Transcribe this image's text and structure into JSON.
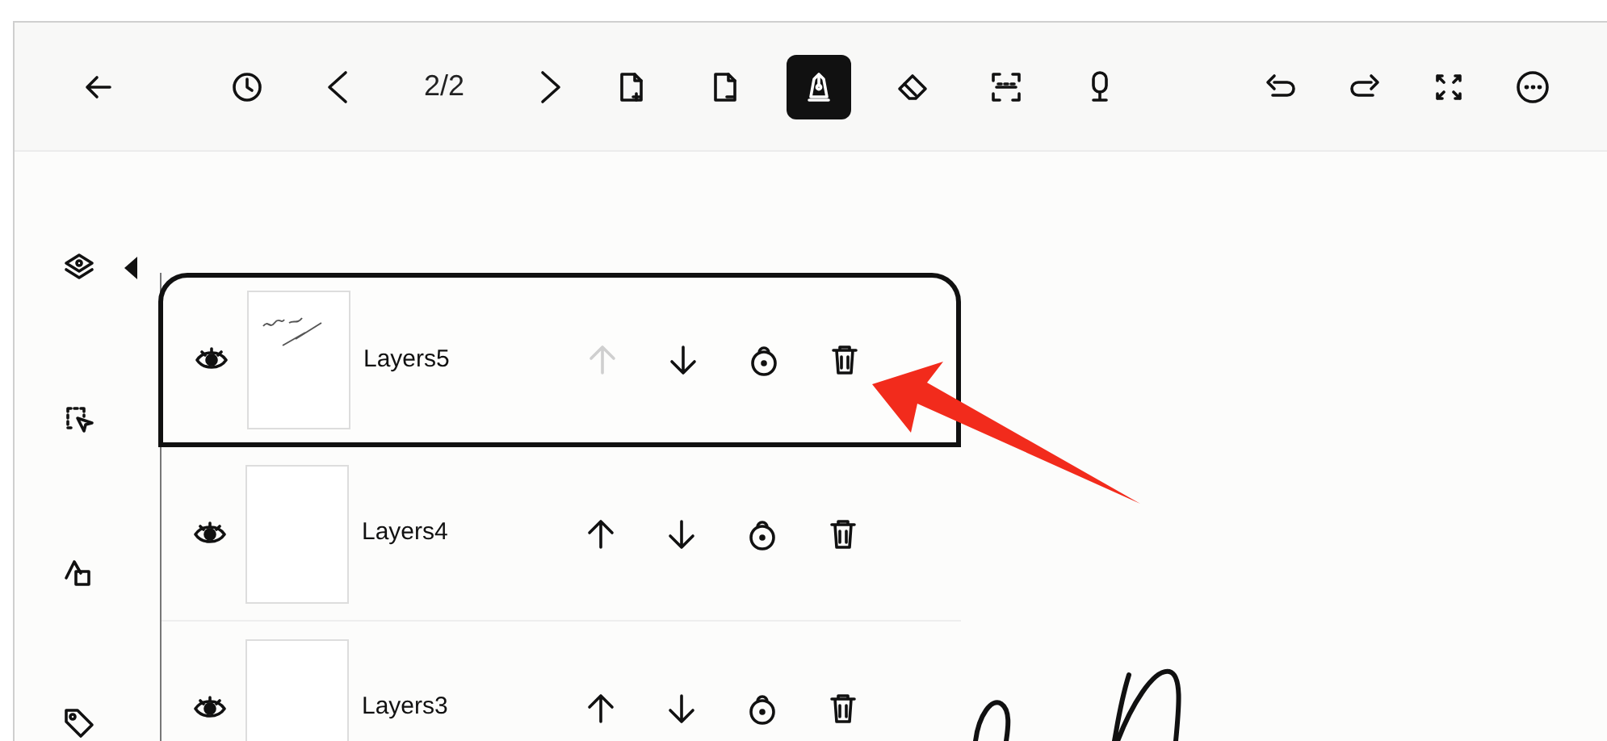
{
  "toolbar": {
    "page_indicator": "2/2",
    "left_tools": [
      {
        "kind": "back"
      },
      {
        "kind": "history"
      },
      {
        "kind": "prev"
      }
    ],
    "right_nav": [
      {
        "kind": "next"
      }
    ],
    "tools": [
      {
        "kind": "add-page",
        "selected": false
      },
      {
        "kind": "remove-page",
        "selected": false
      },
      {
        "kind": "pen",
        "selected": true
      },
      {
        "kind": "eraser",
        "selected": false
      },
      {
        "kind": "ocr",
        "selected": false
      },
      {
        "kind": "mic",
        "selected": false
      }
    ],
    "actions": [
      {
        "kind": "undo"
      },
      {
        "kind": "redo"
      },
      {
        "kind": "fullscreen"
      },
      {
        "kind": "more"
      }
    ]
  },
  "sidebar": {
    "items": [
      {
        "kind": "layers",
        "expanded": true
      },
      {
        "kind": "lasso"
      },
      {
        "kind": "shapes"
      },
      {
        "kind": "tag"
      }
    ]
  },
  "layers": [
    {
      "name": "Layers5",
      "selected": true,
      "visible": true,
      "thumbnail": {
        "kind": "sketch"
      },
      "move_up_disabled": true
    },
    {
      "name": "Layers4",
      "selected": false,
      "visible": true,
      "thumbnail": {
        "kind": "blank"
      },
      "move_up_disabled": false
    },
    {
      "name": "Layers3",
      "selected": false,
      "visible": true,
      "thumbnail": {
        "kind": "blank"
      },
      "move_up_disabled": false
    }
  ]
}
